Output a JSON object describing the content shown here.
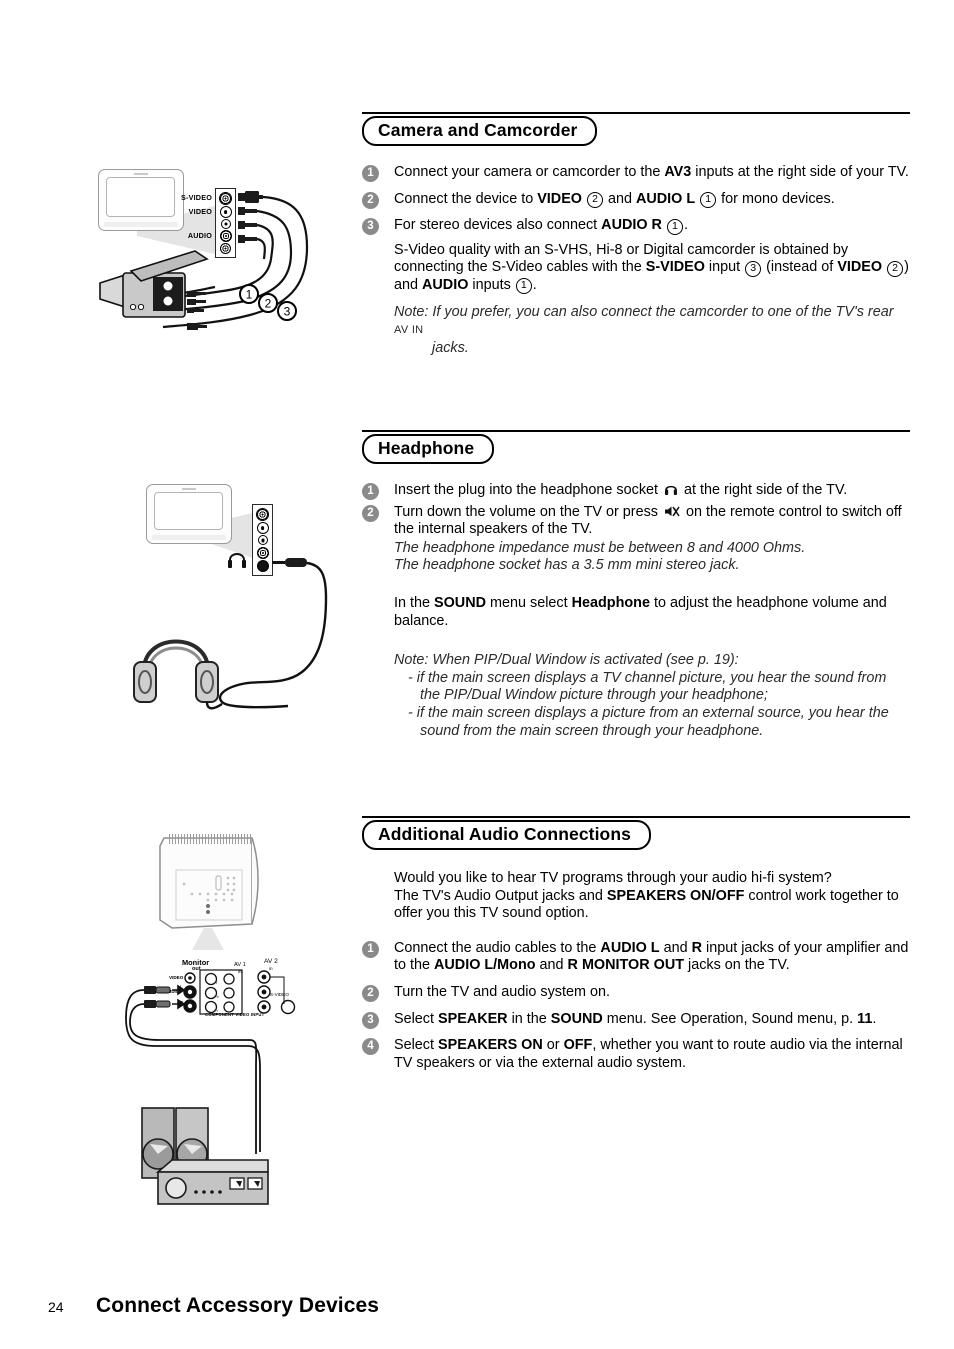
{
  "footer": {
    "page_number": "24",
    "title": "Connect Accessory Devices"
  },
  "sections": [
    {
      "id": "camera-and-camcorder",
      "heading": "Camera and Camcorder",
      "steps": [
        {
          "n": "1",
          "text": "Connect your camera or camcorder to the AV3 inputs at the right side of your TV."
        },
        {
          "n": "2",
          "text": "Connect the device to VIDEO (2) and AUDIO L (1) for mono devices."
        },
        {
          "n": "3",
          "text": "For stereo devices also connect AUDIO R (1)."
        }
      ],
      "paragraph": "S-Video quality with an S-VHS, Hi-8 or Digital camcorder is obtained by connecting the S-Video cables with the S-VIDEO input (3) (instead of VIDEO (2)) and AUDIO inputs (1).",
      "note_label": "Note:",
      "note_text": "If you prefer, you can also connect the camcorder to one of the TV's rear AV IN jacks.",
      "note_smallcaps": "AV IN",
      "note_hang": "jacks."
    },
    {
      "id": "headphone",
      "heading": "Headphone",
      "steps": [
        {
          "n": "1",
          "text": "Insert the plug into the headphone socket [headphone-icon] at the right side of the TV."
        },
        {
          "n": "2",
          "text": "Turn down the volume on the TV or press [mute-icon] on the remote control to switch off the internal speakers of the TV."
        }
      ],
      "italics": [
        "The headphone impedance must be between 8 and 4000 Ohms.",
        "The headphone socket has a 3.5 mm mini stereo jack."
      ],
      "sound_menu_text": "In the SOUND menu select Headphone to adjust the headphone volume and balance.",
      "note_label": "Note:",
      "note_text": "When PIP/Dual Window is activated (see p. 19):",
      "note_bullets": [
        "- if the main screen displays a TV channel picture, you hear the sound from the PIP/Dual Window picture through your headphone;",
        "- if the main screen displays a picture from an external source, you hear the sound from the main screen through your headphone."
      ]
    },
    {
      "id": "additional-audio-connections",
      "heading": "Additional Audio Connections",
      "intro": "Would you like to hear TV programs through your audio hi-fi system? The TV's Audio Output jacks and SPEAKERS ON/OFF control work together to offer you this TV sound option.",
      "steps": [
        {
          "n": "1",
          "text": "Connect the audio cables to the AUDIO L and R input jacks of your amplifier and to the AUDIO L/Mono and R MONITOR OUT jacks on the TV."
        },
        {
          "n": "2",
          "text": "Turn the TV and audio system on."
        },
        {
          "n": "3",
          "text": "Select SPEAKER in the SOUND menu. See Operation, Sound menu, p. 11."
        },
        {
          "n": "4",
          "text": "Select SPEAKERS ON or OFF, whether you want to route audio via the internal TV speakers or via the external audio system."
        }
      ]
    }
  ],
  "illustrations": {
    "camcorder": {
      "jack_labels": [
        "S-VIDEO",
        "VIDEO",
        "AUDIO"
      ],
      "cable_numbers": [
        "1",
        "2",
        "3"
      ]
    },
    "headphone": {},
    "audio": {
      "panel_labels": {
        "monitor_out_1": "Monitor",
        "monitor_out_2": "out",
        "av1_1": "AV 1",
        "av1_2": "in",
        "av2_1": "AV 2",
        "av2_2": "in",
        "video": "VIDEO",
        "audio_l": "L",
        "audio_r": "R",
        "audio": "AUDIO",
        "s_video": "S-VIDEO",
        "component": "COMPONENT VIDEO INPUT",
        "y": "Y",
        "pb": "Pb",
        "pr": "Pr"
      }
    }
  },
  "colors": {
    "text": "#000000",
    "bullet_gray": "#8a8a8a",
    "italic_gray": "#2b2b2b",
    "rule": "#000000"
  }
}
